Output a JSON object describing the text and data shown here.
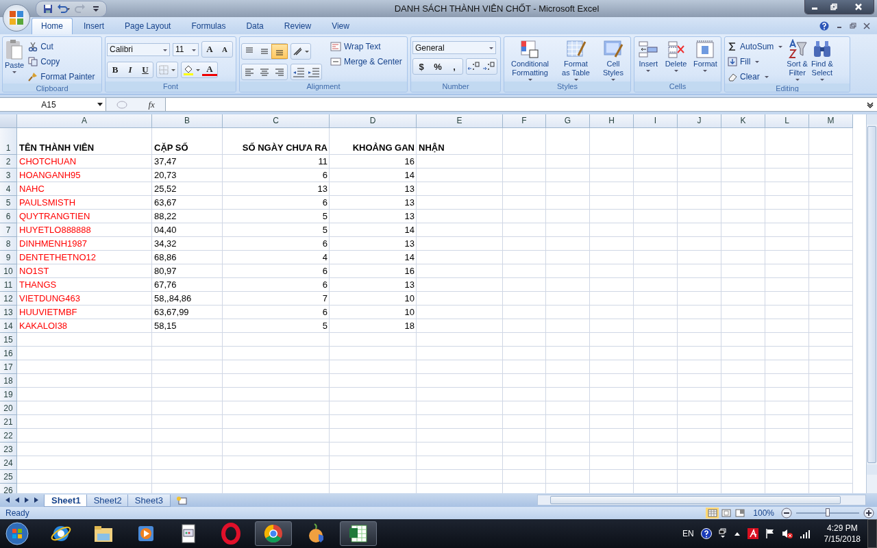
{
  "window": {
    "title": "DANH SÁCH THÀNH VIÊN CHỐT - Microsoft Excel"
  },
  "ribbon_tabs": [
    {
      "label": "Home",
      "selected": true
    },
    {
      "label": "Insert",
      "selected": false
    },
    {
      "label": "Page Layout",
      "selected": false
    },
    {
      "label": "Formulas",
      "selected": false
    },
    {
      "label": "Data",
      "selected": false
    },
    {
      "label": "Review",
      "selected": false
    },
    {
      "label": "View",
      "selected": false
    }
  ],
  "clipboard": {
    "label": "Clipboard",
    "paste": "Paste",
    "items": [
      {
        "kind": "cut",
        "label": "Cut"
      },
      {
        "kind": "copy",
        "label": "Copy"
      },
      {
        "kind": "painter",
        "label": "Format Painter"
      }
    ]
  },
  "font": {
    "label": "Font",
    "name": "Calibri",
    "size": "11",
    "grow": "A",
    "shrink": "A",
    "color_letter": "A",
    "styles": [
      {
        "kind": "bold",
        "label": "B"
      },
      {
        "kind": "italic",
        "label": "I"
      },
      {
        "kind": "underline",
        "label": "U"
      }
    ]
  },
  "alignment": {
    "label": "Alignment",
    "vertical": [
      {
        "selected": false
      },
      {
        "selected": false
      },
      {
        "selected": true
      }
    ],
    "horizontal": [
      {
        "selected": false
      },
      {
        "selected": false
      },
      {
        "selected": false
      }
    ],
    "wrap": "Wrap Text",
    "merge": "Merge & Center"
  },
  "number": {
    "label": "Number",
    "format": "General",
    "symbols": [
      "$",
      "%",
      ","
    ]
  },
  "styles": {
    "label": "Styles",
    "items": [
      {
        "kind": "conditional",
        "lines": [
          "Conditional",
          "Formatting"
        ]
      },
      {
        "kind": "table",
        "lines": [
          "Format",
          "as Table"
        ]
      },
      {
        "kind": "cellstyles",
        "lines": [
          "Cell",
          "Styles"
        ]
      }
    ]
  },
  "cells": {
    "label": "Cells",
    "items": [
      {
        "kind": "insert",
        "label": "Insert"
      },
      {
        "kind": "delete",
        "label": "Delete"
      },
      {
        "kind": "format",
        "label": "Format"
      }
    ]
  },
  "editing": {
    "label": "Editing",
    "small": [
      {
        "kind": "sum",
        "label": "AutoSum"
      },
      {
        "kind": "fill",
        "label": "Fill"
      },
      {
        "kind": "clear",
        "label": "Clear"
      }
    ],
    "big": [
      {
        "kind": "sort",
        "lines": [
          "Sort &",
          "Filter"
        ]
      },
      {
        "kind": "find",
        "lines": [
          "Find &",
          "Select"
        ]
      }
    ]
  },
  "formula_bar": {
    "name_box": "A15",
    "function_label": "fx"
  },
  "sheet": {
    "columns": [
      {
        "letter": "A",
        "kind": "text"
      },
      {
        "letter": "B",
        "kind": "text"
      },
      {
        "letter": "C",
        "kind": "number"
      },
      {
        "letter": "D",
        "kind": "number"
      },
      {
        "letter": "E",
        "kind": "text"
      },
      {
        "letter": "F"
      },
      {
        "letter": "G"
      },
      {
        "letter": "H"
      },
      {
        "letter": "I"
      },
      {
        "letter": "J"
      },
      {
        "letter": "K"
      },
      {
        "letter": "L"
      },
      {
        "letter": "M"
      }
    ],
    "rows": [
      {
        "number": "1",
        "header": true,
        "cells": [
          "TÊN THÀNH VIÊN",
          "CẶP SỐ",
          "SỐ NGÀY CHƯA RA",
          "KHOẢNG GAN",
          "NHẬN"
        ]
      },
      {
        "number": "2",
        "header": false,
        "cells": [
          "CHOTCHUAN",
          "37,47",
          "11",
          "16"
        ]
      },
      {
        "number": "3",
        "header": false,
        "cells": [
          "HOANGANH95",
          "20,73",
          "6",
          "14"
        ]
      },
      {
        "number": "4",
        "header": false,
        "cells": [
          "NAHC",
          "25,52",
          "13",
          "13"
        ]
      },
      {
        "number": "5",
        "header": false,
        "cells": [
          "PAULSMISTH",
          "63,67",
          "6",
          "13"
        ]
      },
      {
        "number": "6",
        "header": false,
        "cells": [
          "QUYTRANGTIEN",
          "88,22",
          "5",
          "13"
        ]
      },
      {
        "number": "7",
        "header": false,
        "cells": [
          "HUYETLO888888",
          "04,40",
          "5",
          "14"
        ]
      },
      {
        "number": "8",
        "header": false,
        "cells": [
          "DINHMENH1987",
          "34,32",
          "6",
          "13"
        ]
      },
      {
        "number": "9",
        "header": false,
        "cells": [
          "DENTETHETNO12",
          "68,86",
          "4",
          "14"
        ]
      },
      {
        "number": "10",
        "header": false,
        "cells": [
          "NO1ST",
          "80,97",
          "6",
          "16"
        ]
      },
      {
        "number": "11",
        "header": false,
        "cells": [
          "THANGS",
          "67,76",
          "6",
          "13"
        ]
      },
      {
        "number": "12",
        "header": false,
        "cells": [
          "VIETDUNG463",
          "58,,84,86",
          "7",
          "10"
        ]
      },
      {
        "number": "13",
        "header": false,
        "cells": [
          "HUUVIETMBF",
          "63,67,99",
          "6",
          "10"
        ]
      },
      {
        "number": "14",
        "header": false,
        "cells": [
          "KAKALOI38",
          "58,15",
          "5",
          "18"
        ]
      },
      {
        "number": "15",
        "header": false,
        "cells": []
      },
      {
        "number": "16",
        "header": false,
        "cells": []
      },
      {
        "number": "17",
        "header": false,
        "cells": []
      },
      {
        "number": "18",
        "header": false,
        "cells": []
      },
      {
        "number": "19",
        "header": false,
        "cells": []
      },
      {
        "number": "20",
        "header": false,
        "cells": []
      },
      {
        "number": "21",
        "header": false,
        "cells": []
      },
      {
        "number": "22",
        "header": false,
        "cells": []
      },
      {
        "number": "23",
        "header": false,
        "cells": []
      },
      {
        "number": "24",
        "header": false,
        "cells": []
      },
      {
        "number": "25",
        "header": false,
        "cells": []
      },
      {
        "number": "26",
        "header": false,
        "cells": []
      }
    ]
  },
  "sheet_tabs": [
    {
      "label": "Sheet1",
      "selected": true
    },
    {
      "label": "Sheet2",
      "selected": false
    },
    {
      "label": "Sheet3",
      "selected": false
    }
  ],
  "status_bar": {
    "text": "Ready",
    "zoom": "100%",
    "zoom_slider": {
      "level": 0.5
    },
    "views": [
      {
        "selected": true
      },
      {
        "selected": false
      },
      {
        "selected": false
      }
    ]
  },
  "taskbar": {
    "apps": [
      {
        "kind": "ie",
        "selected": false
      },
      {
        "kind": "folder",
        "selected": false
      },
      {
        "kind": "media",
        "selected": false
      },
      {
        "kind": "document",
        "selected": false
      },
      {
        "kind": "opera",
        "selected": false
      },
      {
        "kind": "chrome",
        "selected": true
      },
      {
        "kind": "onion",
        "selected": false
      },
      {
        "kind": "excel",
        "selected": true
      }
    ],
    "language": "EN",
    "time": "4:29 PM",
    "date": "7/15/2018"
  }
}
